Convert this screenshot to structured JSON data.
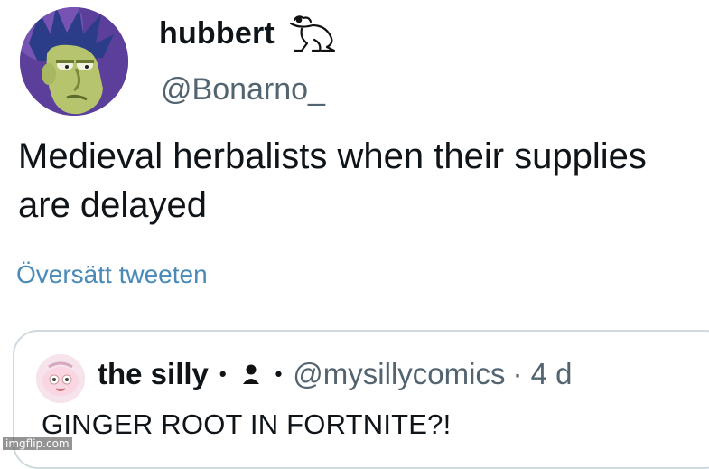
{
  "tweet": {
    "display_name": "hubbert",
    "handle": "@Bonarno_",
    "text": "Medieval herbalists when their supplies are delayed",
    "translate_label": "Översätt tweeten",
    "badge_icon": "frog-icon",
    "avatar_icon": "cartoon-avatar"
  },
  "quote": {
    "display_name": "the silly",
    "separator": "•",
    "badge_icon": "person-icon",
    "handle": "@mysillycomics",
    "time": "· 4 d",
    "text": "GINGER ROOT IN FORTNITE?!",
    "avatar_icon": "cartoon-avatar"
  },
  "watermark": "imgflip.com",
  "colors": {
    "text": "#0f1419",
    "secondary": "#536471",
    "link": "#1d9bf0",
    "border": "#cfd9de"
  }
}
